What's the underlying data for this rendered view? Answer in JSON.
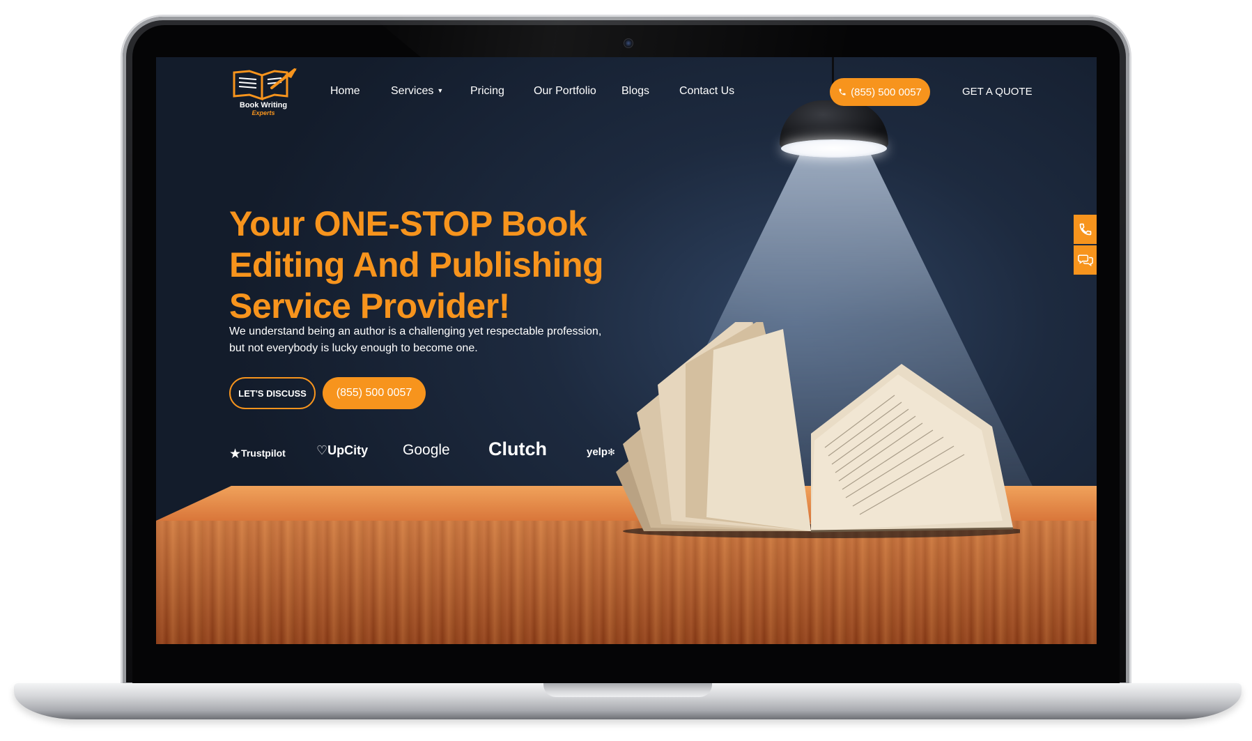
{
  "colors": {
    "accent": "#f7941d",
    "background": "#1d2a3f",
    "text": "#ffffff"
  },
  "logo": {
    "line1": "Book Writing",
    "line2": "Experts"
  },
  "nav": {
    "items": [
      "Home",
      "Services",
      "Pricing",
      "Our Portfolio",
      "Blogs",
      "Contact Us"
    ],
    "phone": "(855) 500 0057",
    "quote": "GET A QUOTE"
  },
  "hero": {
    "title_line1": "Your ONE-STOP Book",
    "title_line2": "Editing And Publishing",
    "title_line3": "Service Provider!",
    "subtitle_line1": "We understand being an author is a challenging yet respectable profession,",
    "subtitle_line2": "but not everybody is lucky enough to become one.",
    "discuss_label": "LET'S DISCUSS",
    "phone_label": "(855) 500 0057"
  },
  "badges": {
    "trustpilot": "Trustpilot",
    "upcity": "UpCity",
    "google": "Google",
    "clutch": "Clutch",
    "yelp": "yelp"
  },
  "icons": {
    "call": "phone-icon",
    "chat": "chat-icon",
    "star": "star-icon",
    "dropdown": "chevron-down-icon"
  }
}
